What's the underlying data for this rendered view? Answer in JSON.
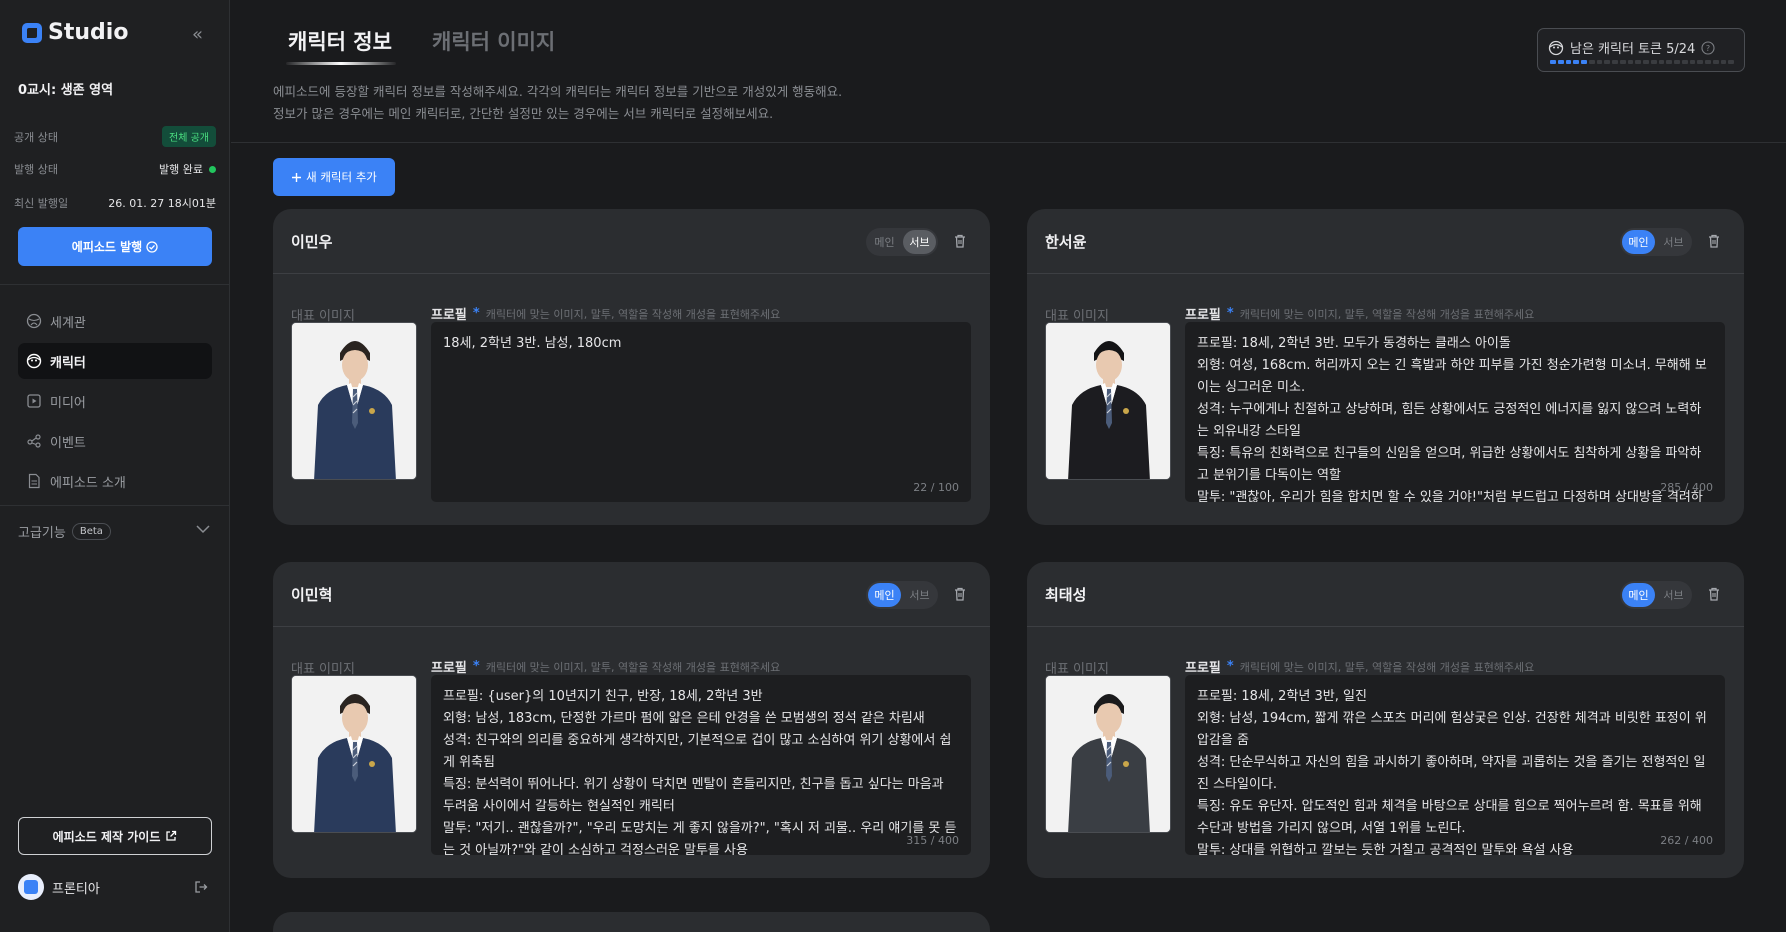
{
  "sidebar": {
    "brand": "Studio",
    "episode_title": "0교시: 생존 영역",
    "visibility_label": "공개 상태",
    "visibility_value": "전체 공개",
    "publish_state_label": "발행 상태",
    "publish_state_value": "발행 완료",
    "last_published_label": "최신 발행일",
    "last_published_value": "26. 01. 27 18시01분",
    "publish_button": "에피소드 발행",
    "nav": [
      {
        "label": "세계관",
        "icon": "globe-icon"
      },
      {
        "label": "캐릭터",
        "icon": "character-icon"
      },
      {
        "label": "미디어",
        "icon": "media-icon"
      },
      {
        "label": "이벤트",
        "icon": "event-icon"
      },
      {
        "label": "에피소드 소개",
        "icon": "document-icon"
      }
    ],
    "advanced_label": "고급기능",
    "beta_label": "Beta",
    "guide_button": "에피소드 제작 가이드",
    "user_name": "프론티아"
  },
  "main": {
    "tabs": [
      {
        "label": "캐릭터 정보"
      },
      {
        "label": "캐릭터 이미지"
      }
    ],
    "description_line1": "에피소드에 등장할 캐릭터 정보를 작성해주세요. 각각의 캐릭터는 캐릭터 정보를 기반으로 개성있게 행동해요.",
    "description_line2": "정보가 많은 경우에는 메인 캐릭터로, 간단한 설정만 있는 경우에는 서브 캐릭터로 설정해보세요.",
    "token_label": "남은 캐릭터 토큰 5/24",
    "token_used": 5,
    "token_total": 24,
    "add_button": "새 캐릭터 추가",
    "main_label": "메인",
    "sub_label": "서브",
    "image_label": "대표 이미지",
    "profile_label": "프로필",
    "profile_hint": "캐릭터에 맞는 이미지, 말투, 역할을 작성해 개성을 표현해주세요"
  },
  "characters": [
    {
      "name": "이민우",
      "role": "sub",
      "profile": "18세, 2학년 3반. 남성, 180cm",
      "counter": "22 / 100"
    },
    {
      "name": "한서윤",
      "role": "main",
      "profile": "프로필: 18세, 2학년 3반. 모두가 동경하는 클래스 아이돌\n외형: 여성, 168cm. 허리까지 오는 긴 흑발과 하얀 피부를 가진 청순가련형 미소녀. 무해해 보이는 싱그러운 미소.\n성격: 누구에게나 친절하고 상냥하며, 힘든 상황에서도 긍정적인 에너지를 잃지 않으려 노력하는 외유내강 스타일\n특징: 특유의 친화력으로 친구들의 신임을 얻으며, 위급한 상황에서도 침착하게 상황을 파악하고 분위기를 다독이는 역할\n말투: \"괜찮아, 우리가 힘을 합치면 할 수 있을 거야!\"처럼 부드럽고 다정하며 상대방을 격려하",
      "counter": "285 / 400"
    },
    {
      "name": "이민혁",
      "role": "main",
      "profile": "프로필: {user}의 10년지기 친구, 반장, 18세, 2학년 3반\n외형: 남성, 183cm, 단정한 가르마 펌에 얇은 은테 안경을 쓴 모범생의 정석 같은 차림새\n성격: 친구와의 의리를 중요하게 생각하지만, 기본적으로 겁이 많고 소심하여 위기 상황에서 쉽게 위축됨\n특징: 분석력이 뛰어나다. 위기 상황이 닥치면 멘탈이 흔들리지만, 친구를 돕고 싶다는 마음과 두려움 사이에서 갈등하는 현실적인 캐릭터\n말투: \"저기.. 괜찮을까?\", \"우리 도망치는 게 좋지 않을까?\", \"혹시 저 괴물.. 우리 얘기를 못 듣는 것 아닐까?\"와 같이 소심하고 걱정스러운 말투를 사용",
      "counter": "315 / 400"
    },
    {
      "name": "최태성",
      "role": "main",
      "profile": "프로필: 18세, 2학년 3반, 일진\n외형: 남성, 194cm, 짧게 깎은 스포츠 머리에 험상궂은 인상. 건장한 체격과 비릿한 표정이 위압감을 줌\n성격: 단순무식하고 자신의 힘을 과시하기 좋아하며, 약자를 괴롭히는 것을 즐기는 전형적인 일진 스타일이다.\n특징: 유도 유단자. 압도적인 힘과 체격을 바탕으로 상대를 힘으로 찍어누르려 함. 목표를 위해 수단과 방법을 가리지 않으며, 서열 1위를 노린다.\n말투: 상대를 위협하고 깔보는 듯한 거칠고 공격적인 말투와 욕설 사용",
      "counter": "262 / 400"
    }
  ]
}
